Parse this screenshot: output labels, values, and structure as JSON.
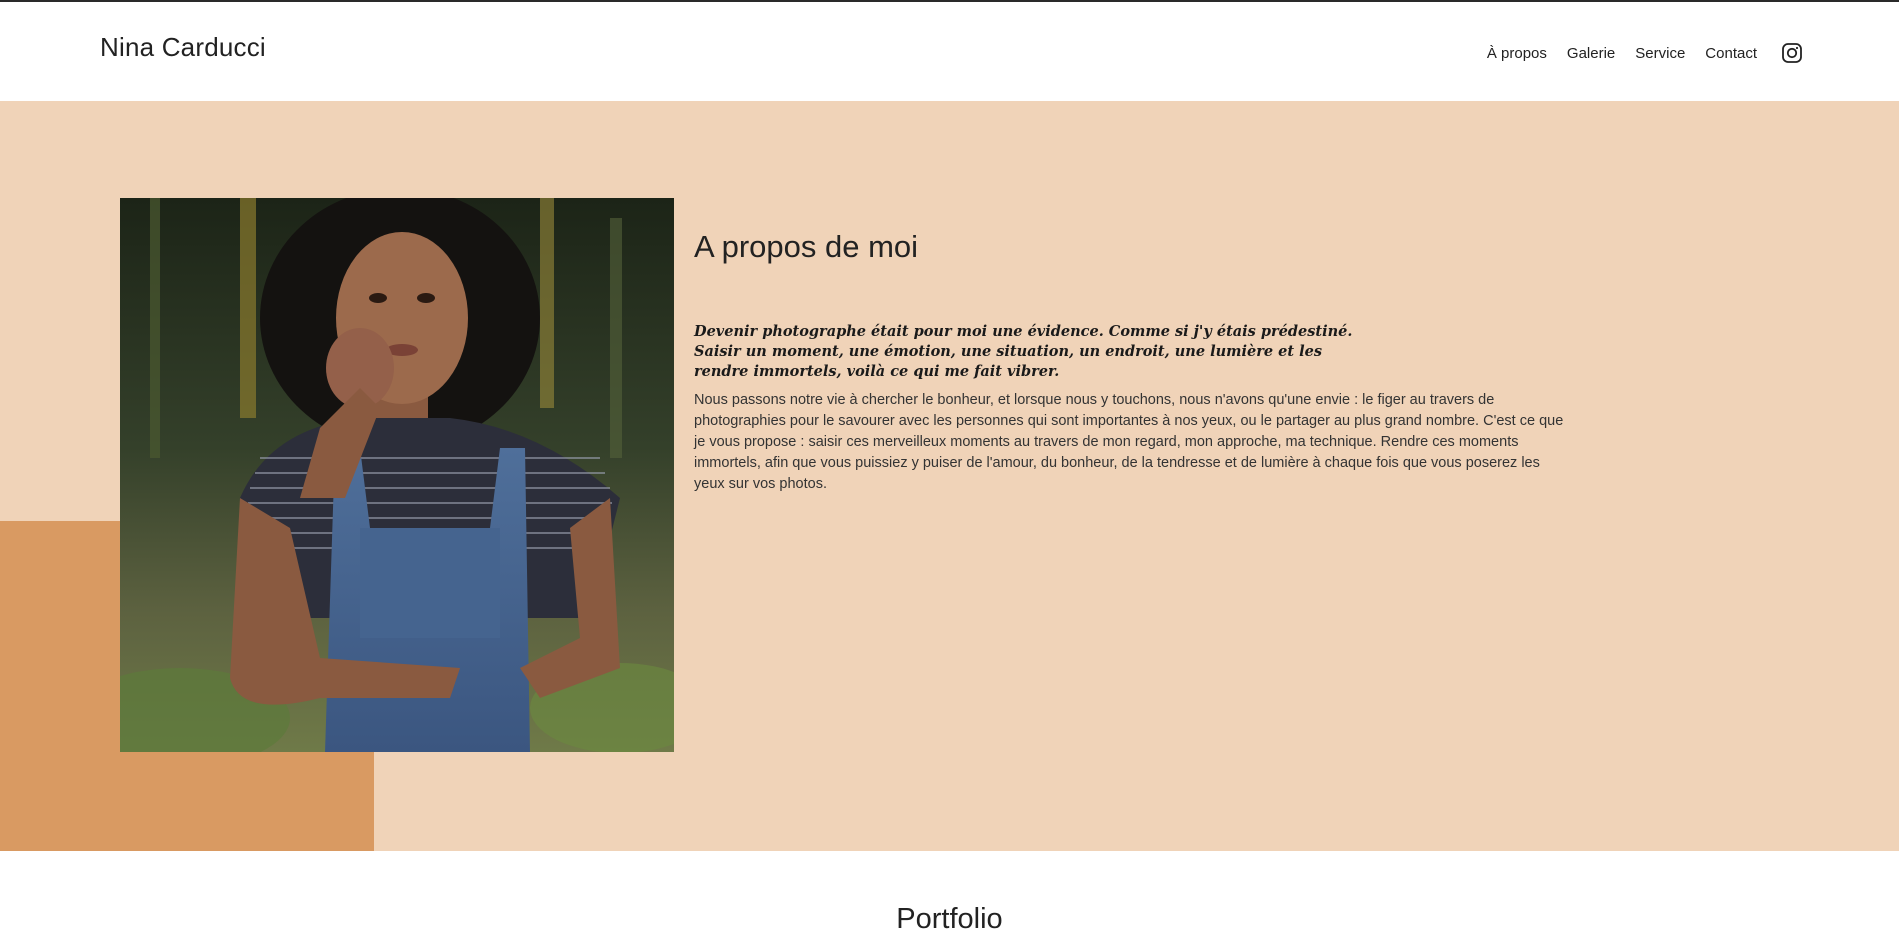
{
  "brand": "Nina Carducci",
  "nav": {
    "about": "À propos",
    "gallery": "Galerie",
    "service": "Service",
    "contact": "Contact",
    "instagram_icon": "instagram-icon"
  },
  "about": {
    "title": "A propos de moi",
    "quote": "Devenir photographe était pour moi une évidence. Comme si j'y étais prédestiné. Saisir un moment, une émotion, une situation, un endroit, une lumière et les rendre immortels, voilà ce qui me fait vibrer.",
    "body": "Nous passons notre vie à chercher le bonheur, et lorsque nous y touchons, nous n'avons qu'une envie : le figer au travers de photographies pour le savourer avec les personnes qui sont importantes à nos yeux, ou le partager au plus grand nombre. C'est ce que je vous propose : saisir ces merveilleux moments au travers de mon regard, mon approche, ma technique. Rendre ces moments immortels, afin que vous puissiez y puiser de l'amour, du bonheur, de la tendresse et de lumière à chaque fois que vous poserez les yeux sur vos photos."
  },
  "portfolio": {
    "title": "Portfolio"
  },
  "colors": {
    "about_bg": "#f0d3b8",
    "accent": "#d99a62",
    "text": "#222222"
  }
}
